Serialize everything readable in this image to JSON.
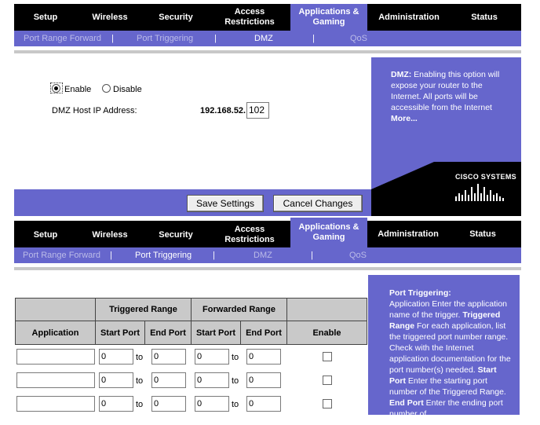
{
  "top": {
    "nav": [
      "Setup",
      "Wireless",
      "Security",
      "Access Restrictions",
      "Applications & Gaming",
      "Administration",
      "Status"
    ],
    "subnav": [
      "Port Range Forward",
      "Port Triggering",
      "DMZ",
      "QoS"
    ],
    "dmz": {
      "enable_label": "Enable",
      "disable_label": "Disable",
      "selected": "Enable",
      "host_label": "DMZ Host IP Address:",
      "ip_prefix": "192.168.52.",
      "ip_last": "102"
    },
    "help": {
      "title": "DMZ:",
      "text": "Enabling this option will expose your router to the Internet. All ports will be accessible from the Internet",
      "more": "More..."
    },
    "logo_text": "CISCO SYSTEMS",
    "buttons": {
      "save": "Save Settings",
      "cancel": "Cancel Changes"
    }
  },
  "bottom": {
    "nav": [
      "Setup",
      "Wireless",
      "Security",
      "Access Restrictions",
      "Applications & Gaming",
      "Administration",
      "Status"
    ],
    "subnav": [
      "Port Range Forward",
      "Port Triggering",
      "DMZ",
      "QoS"
    ],
    "table": {
      "group_triggered": "Triggered Range",
      "group_forwarded": "Forwarded Range",
      "col_application": "Application",
      "col_start": "Start Port",
      "col_end": "End Port",
      "col_enable": "Enable",
      "to_label": "to",
      "rows": [
        {
          "application": "",
          "t_start": "0",
          "t_end": "0",
          "f_start": "0",
          "f_end": "0",
          "enabled": false
        },
        {
          "application": "",
          "t_start": "0",
          "t_end": "0",
          "f_start": "0",
          "f_end": "0",
          "enabled": false
        },
        {
          "application": "",
          "t_start": "0",
          "t_end": "0",
          "f_start": "0",
          "f_end": "0",
          "enabled": false
        }
      ]
    },
    "help": {
      "title": "Port Triggering:",
      "text1": "Application Enter the application name of the trigger.",
      "b1": "Triggered Range",
      "text2": "For each application, list the triggered port number range. Check with the Internet application documentation for the port number(s) needed.",
      "b2": "Start Port",
      "text3": "Enter the starting port number of the Triggered Range.",
      "b3": "End Port",
      "text4": "Enter the ending port number of"
    }
  },
  "colors": {
    "nav_bg": "#000000",
    "accent": "#6666cc",
    "header_cell": "#c9c9c9"
  }
}
